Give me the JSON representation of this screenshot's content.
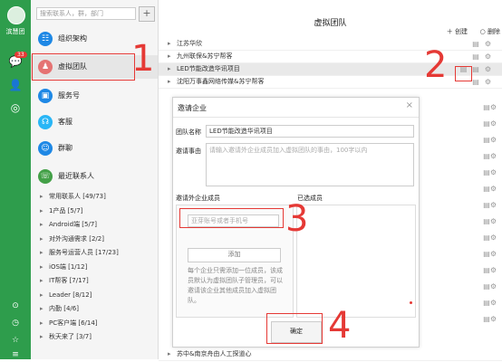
{
  "strip": {
    "username": "滨慧团",
    "badge": "33"
  },
  "sidebar": {
    "search_placeholder": "搜索联系人，群，部门",
    "add_label": "+",
    "nav": [
      {
        "label": "组织架构",
        "icon": "org-chart-icon",
        "color": "#1e88e5"
      },
      {
        "label": "虚拟团队",
        "icon": "virtual-team-icon",
        "color": "#e57373"
      },
      {
        "label": "服务号",
        "icon": "service-account-icon",
        "color": "#1e88e5"
      },
      {
        "label": "客服",
        "icon": "customer-service-icon",
        "color": "#29b6f6"
      },
      {
        "label": "群聊",
        "icon": "group-chat-icon",
        "color": "#1e88e5"
      },
      {
        "label": "最近联系人",
        "icon": "recent-contacts-icon",
        "color": "#43a047"
      }
    ],
    "groups": [
      "常用联系人 [49/73]",
      "1产品 [5/7]",
      "Android端 [5/7]",
      "对外沟通需求 [2/2]",
      "服务号运营人员 [17/23]",
      "iOS端 [1/12]",
      "IT帮客 [7/17]",
      "Leader [8/12]",
      "内勤 [4/6]",
      "PC客户端 [6/14]",
      "秋天来了 [3/7]"
    ]
  },
  "main": {
    "title": "虚拟团队",
    "create_label": "创建",
    "delete_label": "删除",
    "rows": [
      "江苏华欣",
      "九州联保&苏宁帮客",
      "LED节能改造华讯项目",
      "沈阳万事鑫网络传媒&苏宁帮客",
      "苏中&南京舟由人工探道心"
    ]
  },
  "modal": {
    "title": "邀请企业",
    "close": "×",
    "team_name_label": "团队名称",
    "team_name_value": "LED节能改造华讯项目",
    "reason_label": "邀请事由",
    "reason_placeholder": "请输入邀请外企业成员加入虚拟团队的事由，100字以内",
    "members_label": "邀请外企业成员",
    "selected_label": "已选成员",
    "account_placeholder": "亚芽账号或者手机号",
    "add_button": "添加",
    "hint": "每个企业只需添加一位成员，该成员默认为虚拟团队子管理员，可以邀请该企业其他成员加入虚拟团队。",
    "confirm_button": "确定"
  },
  "annotations": [
    "1",
    "2",
    "3",
    "4"
  ],
  "colors": {
    "strip": "#2e9d4c",
    "annotation": "#e53935"
  }
}
